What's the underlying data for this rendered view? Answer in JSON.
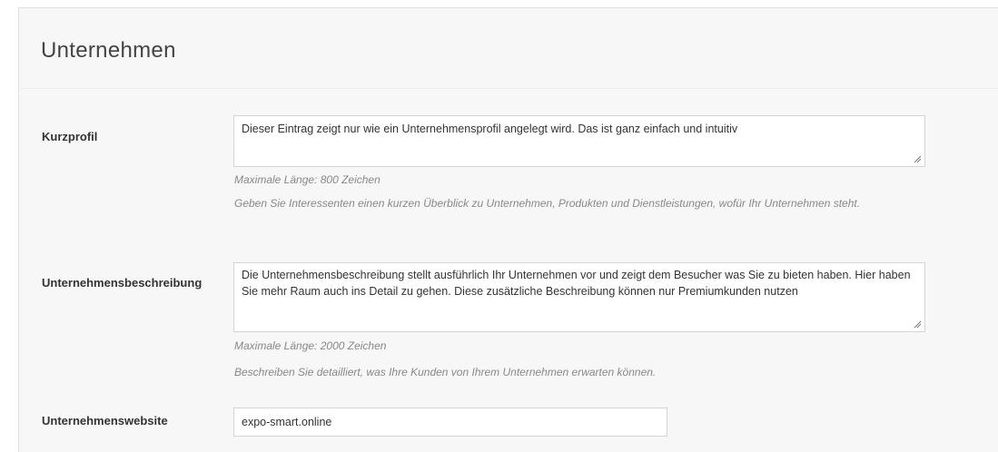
{
  "section": {
    "title": "Unternehmen"
  },
  "fields": {
    "kurzprofil": {
      "label": "Kurzprofil",
      "value": "Dieser Eintrag zeigt nur wie ein Unternehmensprofil angelegt wird. Das ist ganz einfach und intuitiv",
      "max_length": "Maximale Länge: 800 Zeichen",
      "help": "Geben Sie Interessenten einen kurzen Überblick zu Unternehmen, Produkten und Dienstleistungen, wofür Ihr Unternehmen steht."
    },
    "beschreibung": {
      "label": "Unternehmensbeschreibung",
      "value": "Die Unternehmensbeschreibung stellt ausführlich Ihr Unternehmen vor und zeigt dem Besucher was Sie zu bieten haben. Hier haben Sie mehr Raum auch ins Detail zu gehen. Diese zusätzliche Beschreibung können nur Premiumkunden nutzen",
      "max_length": "Maximale Länge: 2000 Zeichen",
      "help": "Beschreiben Sie detailliert, was Ihre Kunden von Ihrem Unternehmen erwarten können."
    },
    "website": {
      "label": "Unternehmenswebsite",
      "value": "expo-smart.online"
    }
  }
}
